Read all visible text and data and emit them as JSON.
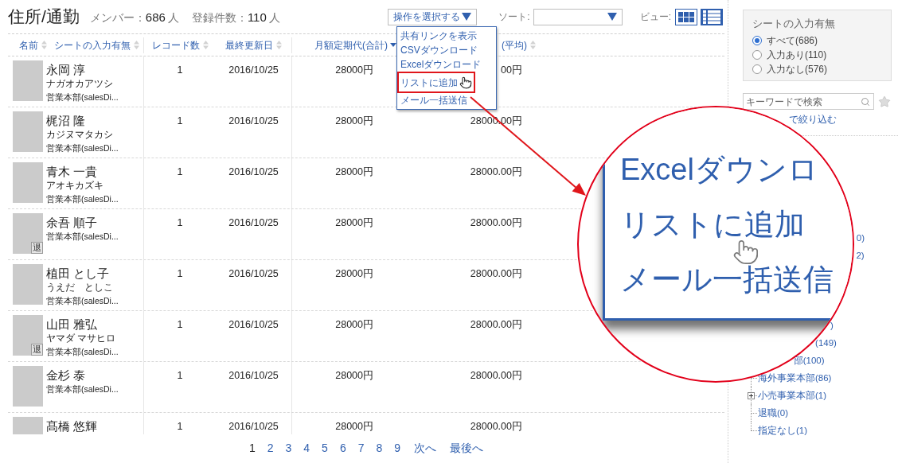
{
  "header": {
    "title": "住所/通勤",
    "stats": [
      {
        "label": "メンバー：",
        "value": "686",
        "unit": "人"
      },
      {
        "label": "登録件数：",
        "value": "110",
        "unit": "人"
      }
    ]
  },
  "toolbar": {
    "action_select": {
      "value": "操作を選択する"
    },
    "sort": {
      "label": "ソート:"
    },
    "view": {
      "label": "ビュー:",
      "modes": [
        {
          "kind": "grid",
          "selected": false
        },
        {
          "kind": "list",
          "selected": true
        }
      ]
    }
  },
  "action_menu": {
    "items": [
      {
        "label": "共有リンクを表示",
        "annotated": false
      },
      {
        "label": "CSVダウンロード",
        "annotated": false
      },
      {
        "label": "Excelダウンロード",
        "annotated": false
      },
      {
        "label": "リストに追加",
        "annotated": true
      },
      {
        "label": "メール一括送信",
        "annotated": false
      }
    ]
  },
  "table": {
    "columns": [
      {
        "label": "名前",
        "sorted": false
      },
      {
        "label": "シートの入力有無",
        "sorted": false
      },
      {
        "label": "レコード数",
        "sorted": false
      },
      {
        "label": "最終更新日",
        "sorted": false
      },
      {
        "label": "月額定期代(合計)",
        "sorted": true
      },
      {
        "label": "(平均)",
        "sorted": false
      }
    ],
    "rows": [
      {
        "name": "永岡 淳",
        "kana": "ナガオカアツシ",
        "department": "営業本部(salesDi...",
        "records": "1",
        "updated": "2016/10/25",
        "monthly_total": "28000円",
        "monthly_average": "00円"
      },
      {
        "name": "梶沼 隆",
        "kana": "カジヌマタカシ",
        "department": "営業本部(salesDi...",
        "records": "1",
        "updated": "2016/10/25",
        "monthly_total": "28000円",
        "monthly_average": "28000.00円"
      },
      {
        "name": "青木 一貴",
        "kana": "アオキカズキ",
        "department": "営業本部(salesDi...",
        "records": "1",
        "updated": "2016/10/25",
        "monthly_total": "28000円",
        "monthly_average": "28000.00円"
      },
      {
        "name": "余吾 順子",
        "department": "営業本部(salesDi...",
        "badge": "退",
        "records": "1",
        "updated": "2016/10/25",
        "monthly_total": "28000円",
        "monthly_average": "28000.00円"
      },
      {
        "name": "植田 とし子",
        "kana": "うえだ　としこ",
        "department": "営業本部(salesDi...",
        "records": "1",
        "updated": "2016/10/25",
        "monthly_total": "28000円",
        "monthly_average": "28000.00円"
      },
      {
        "name": "山田 雅弘",
        "kana": "ヤマダ マサヒロ",
        "department": "営業本部(salesDi...",
        "badge": "退",
        "records": "1",
        "updated": "2016/10/25",
        "monthly_total": "28000円",
        "monthly_average": "28000.00円"
      },
      {
        "name": "金杉 泰",
        "department": "営業本部(salesDi...",
        "records": "1",
        "updated": "2016/10/25",
        "monthly_total": "28000円",
        "monthly_average": "28000.00円"
      },
      {
        "name": "髙橋 悠輝",
        "records": "1",
        "updated": "2016/10/25",
        "monthly_total": "28000円",
        "monthly_average": "28000.00円"
      }
    ]
  },
  "pagination": {
    "pages": [
      {
        "label": "1",
        "selected": true
      },
      {
        "label": "2",
        "selected": false
      },
      {
        "label": "3",
        "selected": false
      },
      {
        "label": "4",
        "selected": false
      },
      {
        "label": "5",
        "selected": false
      },
      {
        "label": "6",
        "selected": false
      },
      {
        "label": "7",
        "selected": false
      },
      {
        "label": "8",
        "selected": false
      },
      {
        "label": "9",
        "selected": false
      }
    ],
    "next": "次へ",
    "last": "最後へ"
  },
  "sidebar": {
    "filter": {
      "title": "シートの入力有無",
      "options": [
        {
          "label": "すべて(686)",
          "selected": true
        },
        {
          "label": "入力あり(110)",
          "selected": false
        },
        {
          "label": "入力なし(576)",
          "selected": false
        }
      ]
    },
    "search": {
      "placeholder": "キーワードで検索"
    },
    "filter_link": "で絞り込む",
    "tree": [
      {
        "label": "0)",
        "kind": "leaf"
      },
      {
        "label": "2)",
        "kind": "leaf"
      },
      {
        "label": ")",
        "kind": "leaf"
      },
      {
        "label": "(149)",
        "kind": "leaf"
      },
      {
        "label": "部(100)",
        "kind": "leaf"
      },
      {
        "label": "海外事業本部(86)",
        "kind": "leaf"
      },
      {
        "label": "小売事業本部(1)",
        "kind": "folder",
        "expanded": false
      },
      {
        "label": "退職(0)",
        "kind": "leaf"
      },
      {
        "label": "指定なし(1)",
        "kind": "leaf"
      }
    ]
  },
  "magnifier": {
    "items": [
      "Excelダウンロ",
      "リストに追加",
      "メール一括送信"
    ]
  }
}
